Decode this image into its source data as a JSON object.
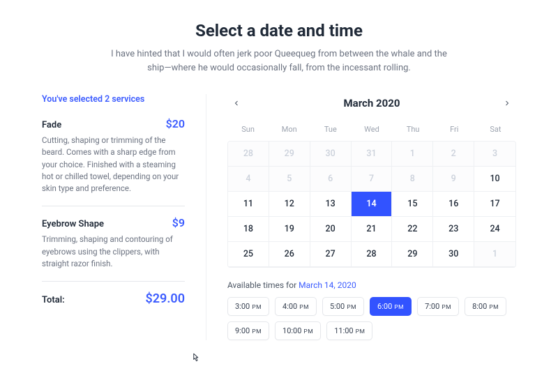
{
  "header": {
    "title": "Select a date and time",
    "subtitle": "I have hinted that I would often jerk poor Queequeg from between the whale and the ship—where he would occasionally fall, from the incessant rolling."
  },
  "sidebar": {
    "selected_label": "You've selected 2 services",
    "services": [
      {
        "name": "Fade",
        "price": "$20",
        "desc": "Cutting, shaping or trimming of the beard. Comes with a sharp edge from your choice. Finished with a steaming hot or chilled towel, depending on your skin type and preference."
      },
      {
        "name": "Eyebrow Shape",
        "price": "$9",
        "desc": "Trimming, shaping and contouring of eyebrows using the clippers, with straight razor finish."
      }
    ],
    "total_label": "Total:",
    "total_value": "$29.00"
  },
  "calendar": {
    "month_label": "March 2020",
    "dow": [
      "Sun",
      "Mon",
      "Tue",
      "Wed",
      "Thu",
      "Fri",
      "Sat"
    ],
    "cells": [
      {
        "n": "28",
        "muted": true
      },
      {
        "n": "29",
        "muted": true
      },
      {
        "n": "30",
        "muted": true
      },
      {
        "n": "31",
        "muted": true
      },
      {
        "n": "1",
        "muted": true
      },
      {
        "n": "2",
        "muted": true
      },
      {
        "n": "3",
        "muted": true
      },
      {
        "n": "4",
        "muted": true
      },
      {
        "n": "5",
        "muted": true
      },
      {
        "n": "6",
        "muted": true
      },
      {
        "n": "7",
        "muted": true
      },
      {
        "n": "8",
        "muted": true
      },
      {
        "n": "9",
        "muted": true
      },
      {
        "n": "10"
      },
      {
        "n": "11"
      },
      {
        "n": "12"
      },
      {
        "n": "13"
      },
      {
        "n": "14",
        "selected": true
      },
      {
        "n": "15"
      },
      {
        "n": "16"
      },
      {
        "n": "17"
      },
      {
        "n": "18"
      },
      {
        "n": "19"
      },
      {
        "n": "20"
      },
      {
        "n": "21"
      },
      {
        "n": "22"
      },
      {
        "n": "23"
      },
      {
        "n": "24"
      },
      {
        "n": "25"
      },
      {
        "n": "26"
      },
      {
        "n": "27"
      },
      {
        "n": "28"
      },
      {
        "n": "29"
      },
      {
        "n": "30"
      },
      {
        "n": "1",
        "muted": true
      }
    ]
  },
  "times": {
    "label_prefix": "Available times for ",
    "label_date": "March 14, 2020",
    "slots": [
      {
        "t": "3:00",
        "p": "PM"
      },
      {
        "t": "4:00",
        "p": "PM"
      },
      {
        "t": "5:00",
        "p": "PM"
      },
      {
        "t": "6:00",
        "p": "PM",
        "selected": true
      },
      {
        "t": "7:00",
        "p": "PM"
      },
      {
        "t": "8:00",
        "p": "PM"
      },
      {
        "t": "9:00",
        "p": "PM"
      },
      {
        "t": "10:00",
        "p": "PM"
      },
      {
        "t": "11:00",
        "p": "PM"
      }
    ]
  }
}
